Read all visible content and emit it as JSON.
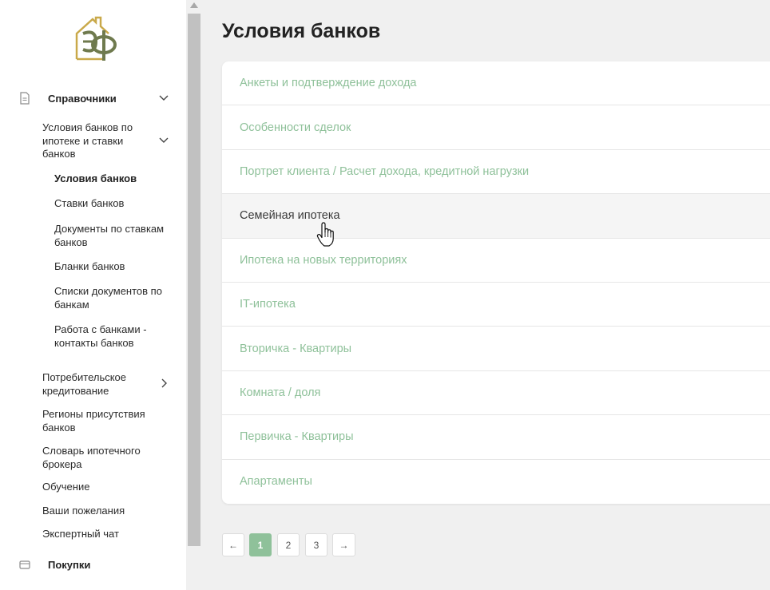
{
  "page": {
    "title": "Условия банков"
  },
  "sidebar": {
    "section": {
      "label": "Справочники",
      "icon": "document-icon"
    },
    "group": {
      "label": "Условия банков по ипотеке и ставки банков"
    },
    "subitems": [
      {
        "label": "Условия банков",
        "active": true
      },
      {
        "label": "Ставки банков"
      },
      {
        "label": "Документы по ставкам банков"
      },
      {
        "label": "Бланки банков"
      },
      {
        "label": "Списки документов по банкам"
      },
      {
        "label": "Работа с банками - контакты банков"
      }
    ],
    "items": [
      {
        "label": "Потребительское кредитование"
      },
      {
        "label": "Регионы присутствия банков"
      },
      {
        "label": "Словарь ипотечного брокера"
      },
      {
        "label": "Обучение"
      },
      {
        "label": "Ваши пожелания"
      },
      {
        "label": "Экспертный чат"
      }
    ],
    "purchases": {
      "label": "Покупки",
      "icon": "wallet-icon"
    }
  },
  "list": [
    {
      "label": "Анкеты и подтверждение дохода"
    },
    {
      "label": "Особенности сделок"
    },
    {
      "label": "Портрет клиента / Расчет дохода, кредитной нагрузки"
    },
    {
      "label": "Семейная ипотека"
    },
    {
      "label": "Ипотека на новых территориях"
    },
    {
      "label": "IT-ипотека"
    },
    {
      "label": "Вторичка - Квартиры"
    },
    {
      "label": "Комната / доля"
    },
    {
      "label": "Первичка - Квартиры"
    },
    {
      "label": "Апартаменты"
    }
  ],
  "pagination": {
    "prev": "←",
    "pages": [
      "1",
      "2",
      "3"
    ],
    "next": "→",
    "current": "1"
  },
  "colors": {
    "accent": "#8fc19a",
    "logo_gold": "#c9a94a",
    "logo_olive": "#6f7a4e"
  }
}
